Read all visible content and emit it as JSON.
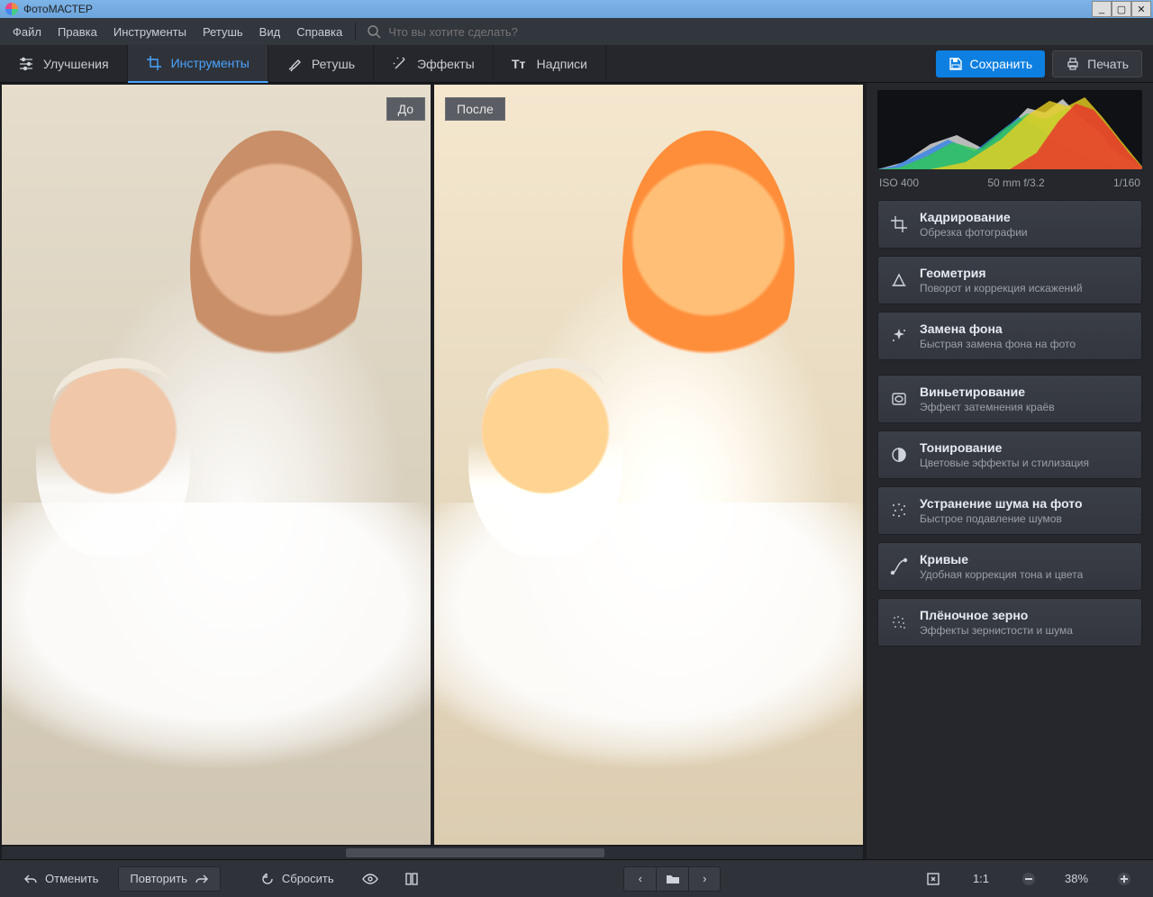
{
  "app": {
    "title": "ФотоМАСТЕР"
  },
  "menu": {
    "items": [
      "Файл",
      "Правка",
      "Инструменты",
      "Ретушь",
      "Вид",
      "Справка"
    ],
    "search_placeholder": "Что вы хотите сделать?"
  },
  "toolbar": {
    "tabs": [
      {
        "label": "Улучшения"
      },
      {
        "label": "Инструменты"
      },
      {
        "label": "Ретушь"
      },
      {
        "label": "Эффекты"
      },
      {
        "label": "Надписи"
      }
    ],
    "save_label": "Сохранить",
    "print_label": "Печать"
  },
  "canvas": {
    "before_label": "До",
    "after_label": "После"
  },
  "meta": {
    "iso": "ISO 400",
    "lens": "50 mm f/3.2",
    "shutter": "1/160"
  },
  "tools": {
    "group1": [
      {
        "title": "Кадрирование",
        "desc": "Обрезка фотографии",
        "icon": "crop"
      },
      {
        "title": "Геометрия",
        "desc": "Поворот и коррекция искажений",
        "icon": "geometry"
      },
      {
        "title": "Замена фона",
        "desc": "Быстрая замена фона на фото",
        "icon": "bgswap"
      }
    ],
    "group2": [
      {
        "title": "Виньетирование",
        "desc": "Эффект затемнения краёв",
        "icon": "vignette"
      },
      {
        "title": "Тонирование",
        "desc": "Цветовые эффекты и стилизация",
        "icon": "toning"
      },
      {
        "title": "Устранение шума на фото",
        "desc": "Быстрое подавление шумов",
        "icon": "denoise"
      },
      {
        "title": "Кривые",
        "desc": "Удобная коррекция тона и цвета",
        "icon": "curves"
      },
      {
        "title": "Плёночное зерно",
        "desc": "Эффекты зернистости и шума",
        "icon": "grain"
      }
    ]
  },
  "bottom": {
    "undo": "Отменить",
    "redo": "Повторить",
    "reset": "Сбросить",
    "one_to_one": "1:1",
    "zoom": "38%"
  }
}
